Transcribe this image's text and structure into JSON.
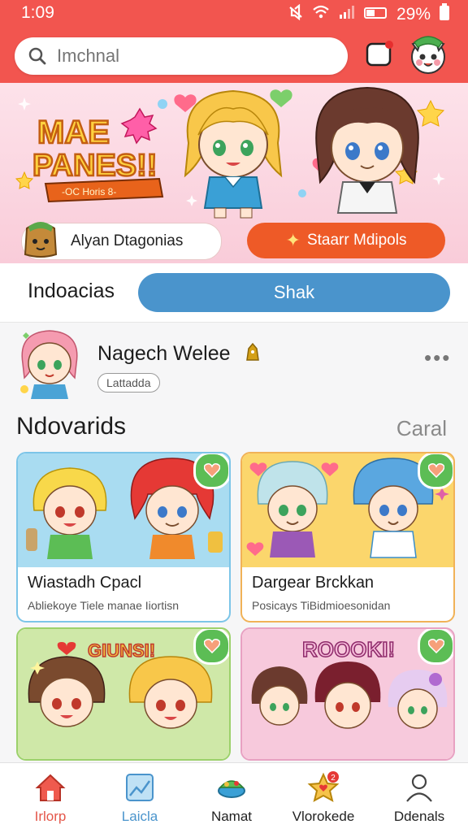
{
  "status_bar": {
    "time": "1:09",
    "battery": "29%"
  },
  "search": {
    "placeholder": "Imchnal"
  },
  "banner": {
    "logo_line1": "MAE",
    "logo_line2": "PANES!!",
    "logo_ribbon": "-OC Horis 8-",
    "button_left": "Alyan Dtagonias",
    "button_right": "Staarr Mdipols"
  },
  "tabs": {
    "left": "Indoacias",
    "right": "Shak"
  },
  "profile": {
    "name": "Nagech Welee",
    "badge": "Lattadda"
  },
  "section": {
    "title": "Ndovarids",
    "link": "Caral"
  },
  "cards": [
    {
      "title": "Wiastadh Cpacl",
      "subtitle": "Abliekoye Tiele manae Iiortisn",
      "bg": "#a9dcf1",
      "border": "#7cc5e8"
    },
    {
      "title": "Dargear Brckkan",
      "subtitle": "Posicays TiBidmioesonidan",
      "bg": "#fbd66c",
      "border": "#f1b257"
    },
    {
      "title": "",
      "subtitle": "",
      "banner_text": "GIUNSI!",
      "bg": "#cfe8a8",
      "border": "#9cd16b"
    },
    {
      "title": "",
      "subtitle": "",
      "banner_text": "ROOOKI!",
      "bg": "#f7c9dc",
      "border": "#e8a1c2"
    }
  ],
  "bottom_nav": [
    {
      "label": "Irlorp",
      "icon": "home-icon"
    },
    {
      "label": "Laicla",
      "icon": "chart-icon"
    },
    {
      "label": "Namat",
      "icon": "bowl-icon"
    },
    {
      "label": "Vlorokede",
      "icon": "star-icon",
      "badge": "2"
    },
    {
      "label": "Ddenals",
      "icon": "person-icon"
    }
  ],
  "colors": {
    "brand": "#f2554f",
    "accent_orange": "#ee5a27",
    "tab_blue": "#4a94cc",
    "heart_green": "#5cbd55"
  }
}
